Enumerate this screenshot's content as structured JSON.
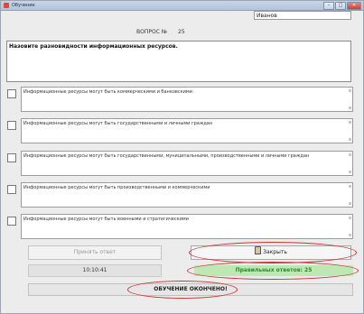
{
  "window": {
    "title": "Обучение",
    "controls": [
      "–",
      "□",
      "✕"
    ]
  },
  "header": {
    "student_name": "Иванов",
    "question_label": "ВОПРОС №",
    "question_number": "25"
  },
  "question": {
    "text": "Назовите разновидности информационных ресурсов."
  },
  "answers": [
    {
      "text": "Информационные ресурсы могут быть коммерческими и банковскими",
      "checked": false
    },
    {
      "text": "Информационные ресурсы могут быть государственными и личными граждан",
      "checked": false
    },
    {
      "text": "Информационные ресурсы могут быть государственными, муниципальными, производственными и личными граждан",
      "checked": false
    },
    {
      "text": "Информационные ресурсы могут быть производственными и коммерческими",
      "checked": false
    },
    {
      "text": "Информационные ресурсы могут быть военными и стратегическими",
      "checked": false
    }
  ],
  "controls": {
    "accept_label": "Принять ответ",
    "close_label": "Закрыть",
    "timer": "10:10:41",
    "result_text": "Правильных ответов: 25",
    "finished_text": "ОБУЧЕНИЕ ОКОНЧЕНО!"
  },
  "colors": {
    "highlight": "#cc3333",
    "result_bg": "#bde8b3",
    "result_text": "#2b8a2b"
  }
}
